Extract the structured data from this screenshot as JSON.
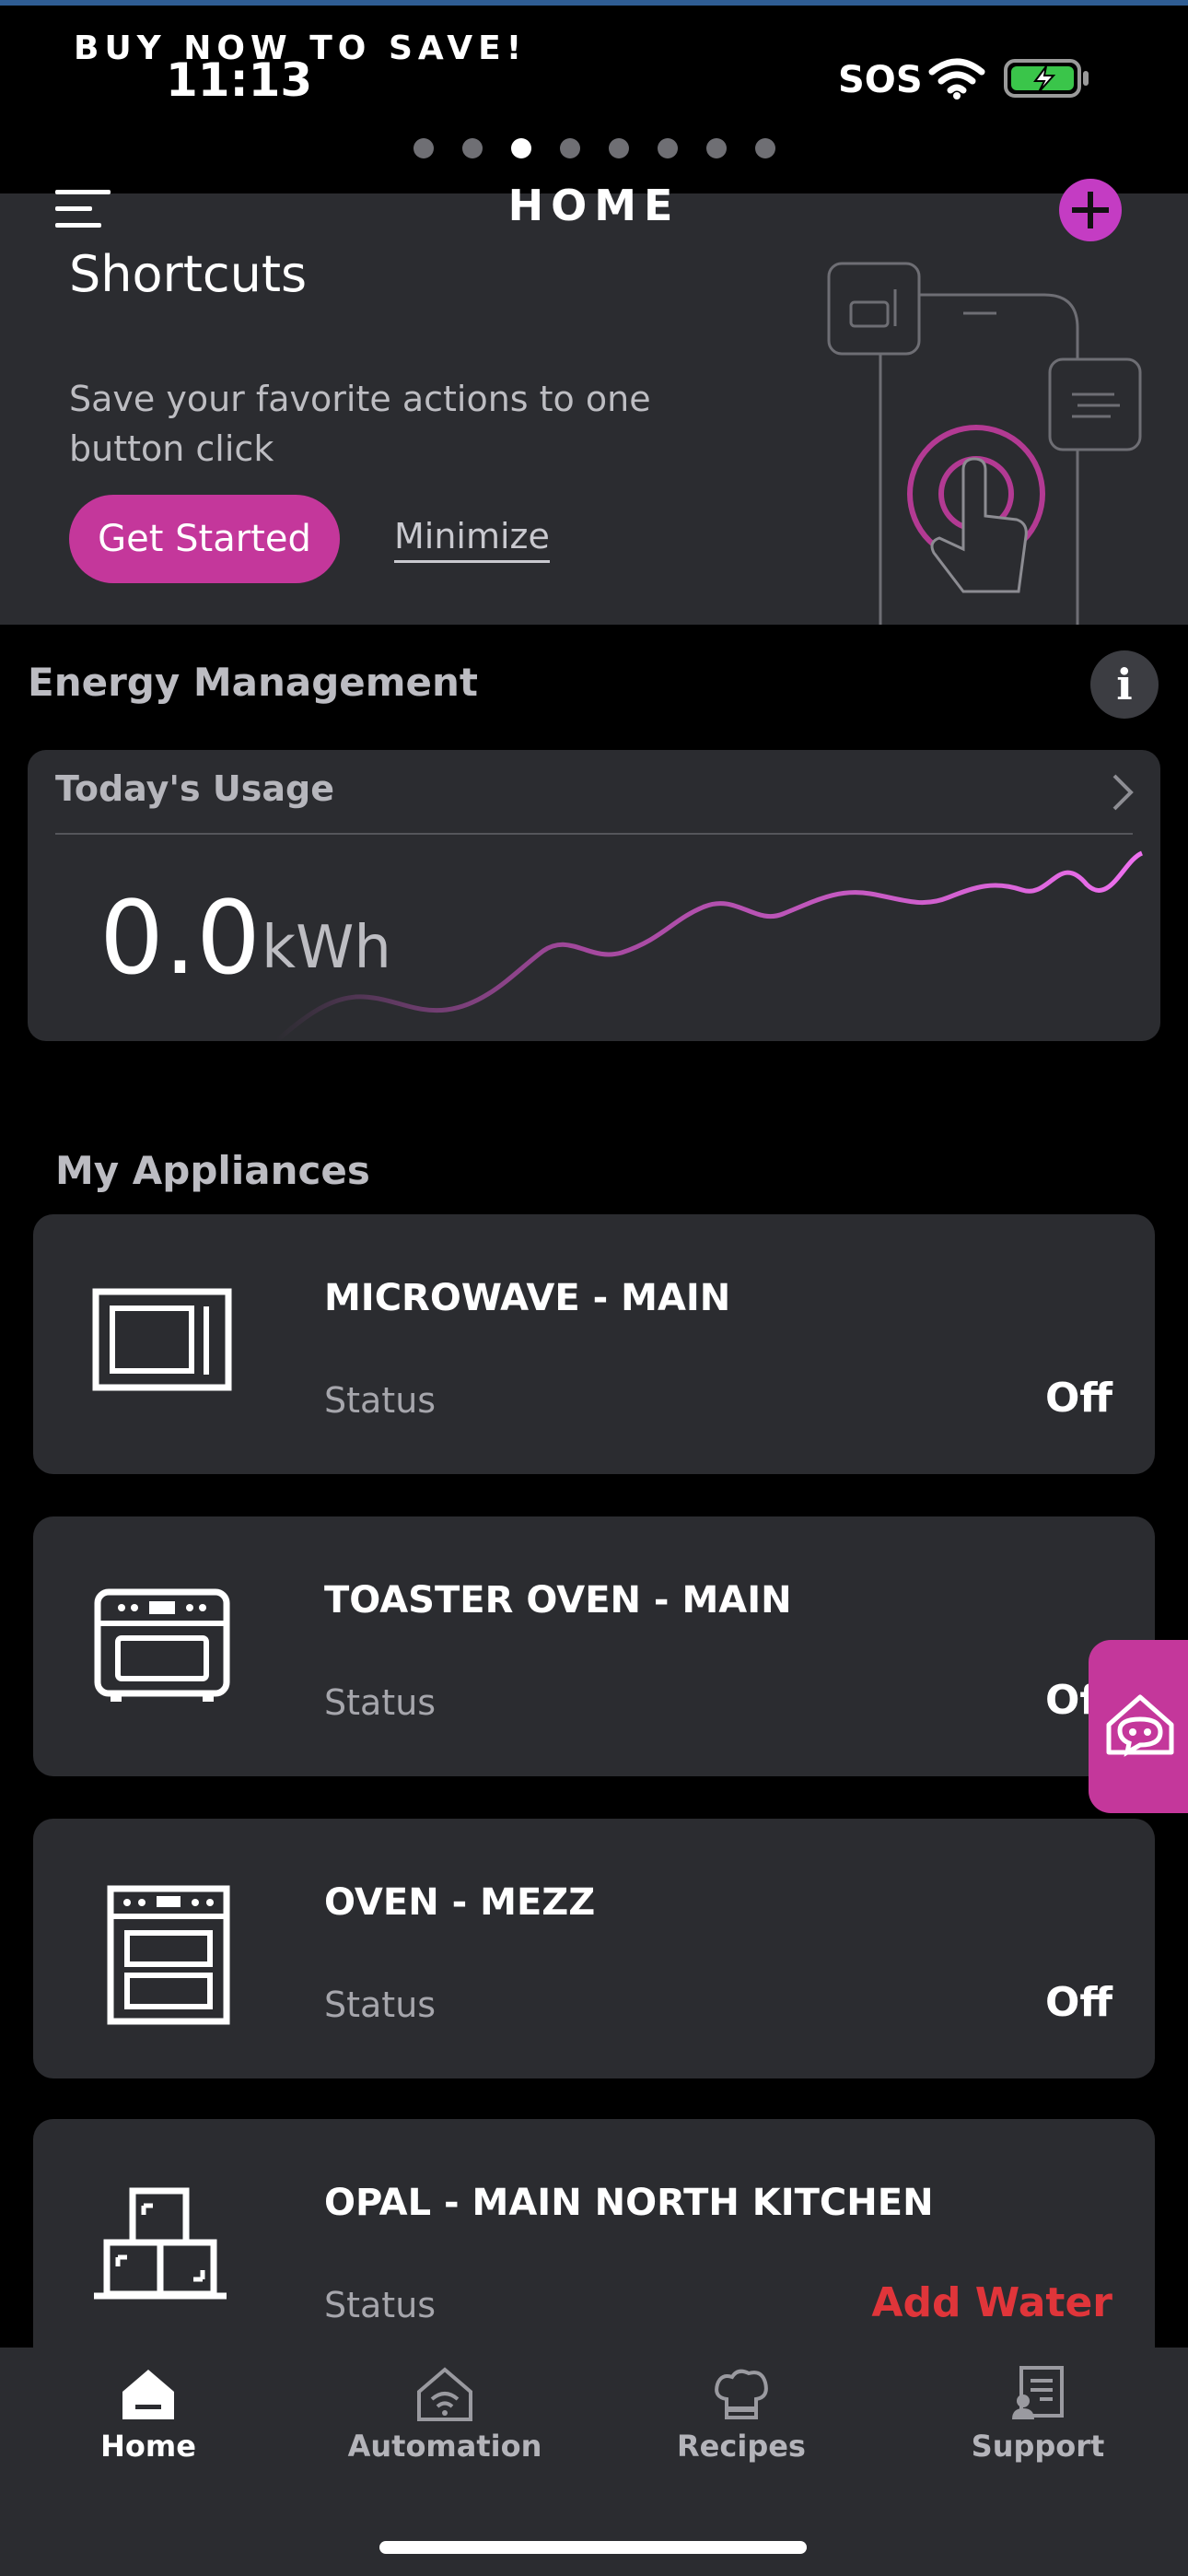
{
  "status_bar": {
    "promo": "BUY NOW TO SAVE!",
    "time": "11:13",
    "carrier": "SOS"
  },
  "pager": {
    "count": 8,
    "active_index": 2
  },
  "header": {
    "title": "HOME"
  },
  "shortcuts": {
    "title": "Shortcuts",
    "description": "Save your favorite actions to one button click",
    "primary_button": "Get Started",
    "secondary_link": "Minimize"
  },
  "energy": {
    "section_title": "Energy Management",
    "info_label": "i",
    "card_title": "Today's Usage",
    "value": "0.0",
    "unit": "kWh"
  },
  "appliances": {
    "section_title": "My Appliances",
    "status_label": "Status",
    "items": [
      {
        "name": "MICROWAVE - MAIN",
        "status": "Off",
        "icon": "microwave-icon"
      },
      {
        "name": "TOASTER OVEN - MAIN",
        "status": "Off",
        "icon": "toaster-oven-icon"
      },
      {
        "name": "OVEN - MEZZ",
        "status": "Off",
        "icon": "oven-icon"
      },
      {
        "name": "OPAL - MAIN NORTH KITCHEN",
        "status": "Add Water",
        "icon": "ice-maker-icon"
      }
    ]
  },
  "tabs": [
    {
      "label": "Home",
      "icon": "home-icon",
      "active": true
    },
    {
      "label": "Automation",
      "icon": "automation-icon",
      "active": false
    },
    {
      "label": "Recipes",
      "icon": "chef-hat-icon",
      "active": false
    },
    {
      "label": "Support",
      "icon": "support-icon",
      "active": false
    }
  ],
  "colors": {
    "accent": "#c4379b",
    "plus_button": "#c43cc3",
    "warning": "#e0353a",
    "card": "#2b2c30",
    "background": "#000000"
  }
}
